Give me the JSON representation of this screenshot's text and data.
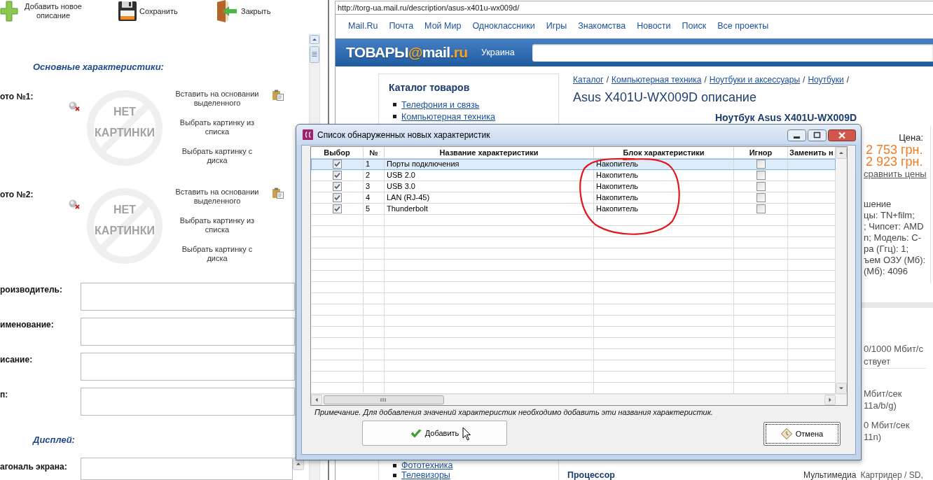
{
  "editor": {
    "toolbar": [
      {
        "kind": "add",
        "label": "Добавить новое описание"
      },
      {
        "kind": "save",
        "label": "Сохранить"
      },
      {
        "kind": "close",
        "label": "Закрыть"
      }
    ],
    "main_heading": "Основные характеристики:",
    "photos": [
      {
        "label": "ото №1:",
        "no_image_text": "НЕТ КАРТИНКИ",
        "actions": [
          "Вставить на основании выделенного",
          "Выбрать картинку из списка",
          "Выбрать картинку с диска"
        ]
      },
      {
        "label": "ото №2:",
        "no_image_text": "НЕТ КАРТИНКИ",
        "actions": [
          "Вставить на основании выделенного",
          "Выбрать картинку из списка",
          "Выбрать картинку с диска"
        ]
      }
    ],
    "fields": [
      {
        "label": "роизводитель:"
      },
      {
        "label": "именование:"
      },
      {
        "label": "исание:"
      },
      {
        "label": "п:"
      }
    ],
    "display_heading": "Дисплей:",
    "display_fields": [
      {
        "label": "агональ экрана:"
      }
    ]
  },
  "browser": {
    "address": "http://torg-ua.mail.ru/description/asus-x401u-wx009d/",
    "nav": [
      "Mail.Ru",
      "Почта",
      "Мой Мир",
      "Одноклассники",
      "Игры",
      "Знакомства",
      "Новости",
      "Поиск",
      "Все проекты"
    ],
    "logo": [
      {
        "text": "ТОВАРЫ",
        "color": "#ffffff"
      },
      {
        "text": "@",
        "color": "#f7a623"
      },
      {
        "text": "mail",
        "color": "#ffffff"
      },
      {
        "text": ".ru",
        "color": "#f7a623"
      }
    ],
    "region": "Украина",
    "catalog": {
      "title": "Каталог товаров",
      "links": [
        "Телефония и связь",
        "Компьютерная техника"
      ],
      "more_links": [
        "Фототехника",
        "Телевизоры"
      ]
    },
    "breadcrumbs": {
      "items": [
        "Каталог",
        "Компьютерная техника",
        "Ноутбуки и аксессуары",
        "Ноутбуки"
      ],
      "separator": "/"
    },
    "title": "Asus X401U-WX009D описание",
    "product_name": "Ноутбук Asus X401U-WX009D",
    "price": {
      "label": "Цена:",
      "values": [
        "2 753 грн.",
        "2 923 грн."
      ],
      "compare_link": "сравнить цены"
    },
    "spec_fragments": [
      "шение",
      "цы: TN+film;",
      "; Чипсет: AMD",
      "n; Модель: C-",
      "ра (Ггц): 1;",
      "ъем ОЗУ (Мб):",
      "(Мб): 4096"
    ],
    "network_fragments": [
      "0/1000 Мбит/с",
      "ствует"
    ],
    "wifi_groups": [
      [
        "Мбит/сек",
        "11a/b/g)"
      ],
      [
        "0 Мбит/сек",
        "11n)"
      ]
    ],
    "bottom_row": {
      "heading": "Процессор",
      "label": "Мультимедиа",
      "value": "Картридер / SD,"
    }
  },
  "dialog": {
    "title": "Список обнаруженных новых характеристик",
    "columns": [
      "Выбор",
      "№",
      "Название характеристики",
      "Блок характеристики",
      "Игнор",
      "Заменить н"
    ],
    "rows": [
      {
        "selected": true,
        "checked": true,
        "number": "1",
        "name": "Порты подключения",
        "block": "Накопитель",
        "ignored": false
      },
      {
        "selected": false,
        "checked": true,
        "number": "2",
        "name": "USB 2.0",
        "block": "Накопитель",
        "ignored": false
      },
      {
        "selected": false,
        "checked": true,
        "number": "3",
        "name": "USB 3.0",
        "block": "Накопитель",
        "ignored": false
      },
      {
        "selected": false,
        "checked": true,
        "number": "4",
        "name": "LAN (RJ-45)",
        "block": "Накопитель",
        "ignored": false
      },
      {
        "selected": false,
        "checked": true,
        "number": "5",
        "name": "Thunderbolt",
        "block": "Накопитель",
        "ignored": false
      }
    ],
    "note": "Примечание. Для добавления значений характеристик необходимо добавить эти названия характеристик.",
    "buttons": [
      {
        "kind": "confirm",
        "label": "Добавить",
        "focused": false
      },
      {
        "kind": "cancel",
        "label": "Отмена",
        "focused": true
      }
    ]
  }
}
